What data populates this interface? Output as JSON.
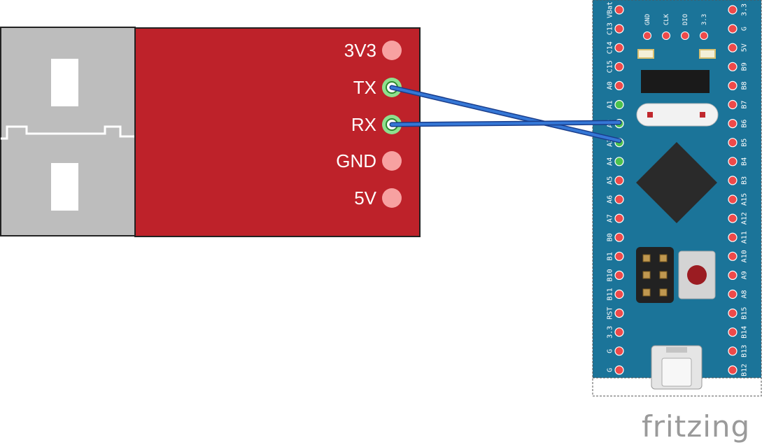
{
  "usb_adapter": {
    "pins": [
      "3V3",
      "TX",
      "RX",
      "GND",
      "5V"
    ],
    "connected_pins": [
      "TX",
      "RX"
    ],
    "colors": {
      "board": "#be222a",
      "pad": "#f7a1a1",
      "pad_connected": "#8ee08e",
      "connector": "#bdbdbd"
    }
  },
  "mcu_board": {
    "left_pins": [
      "VBat",
      "C13",
      "C14",
      "C15",
      "A0",
      "A1",
      "A2",
      "A3",
      "A4",
      "A5",
      "A6",
      "A7",
      "B0",
      "B1",
      "B10",
      "B11",
      "RST",
      "3.3",
      "G",
      "G"
    ],
    "right_pins": [
      "3.3",
      "G",
      "5V",
      "B9",
      "B8",
      "B7",
      "B6",
      "B5",
      "B4",
      "B3",
      "A15",
      "A12",
      "A11",
      "A10",
      "A9",
      "A8",
      "B15",
      "B14",
      "B13",
      "B12"
    ],
    "top_labels": [
      "GND",
      "CLK",
      "DIO",
      "3.3"
    ],
    "highlighted_left_pins": [
      "A1",
      "A2",
      "A3",
      "A4"
    ],
    "colors": {
      "board": "#1b7499",
      "pad": "#ee4a4a",
      "pad_green": "#4cc24c",
      "chip": "#222222"
    }
  },
  "wires": [
    {
      "from": "TX",
      "to": "A3"
    },
    {
      "from": "RX",
      "to": "A2"
    }
  ],
  "wire_color": "#2a6fd6",
  "watermark": "fritzing"
}
